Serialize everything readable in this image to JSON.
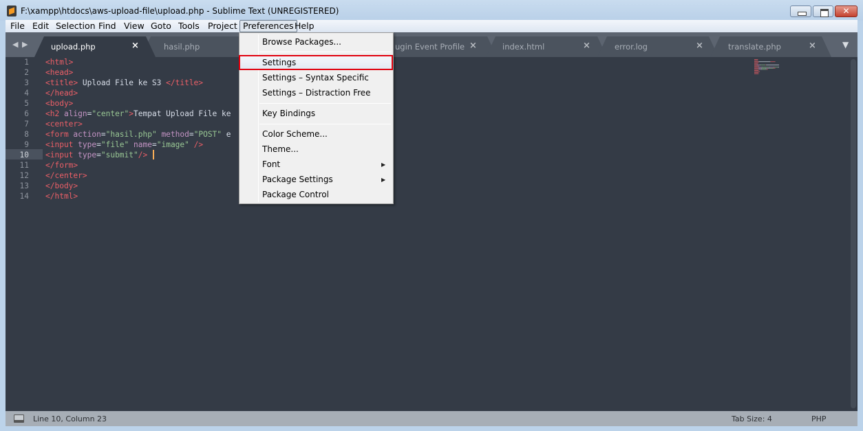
{
  "window": {
    "title": "F:\\xampp\\htdocs\\aws-upload-file\\upload.php - Sublime Text (UNREGISTERED)",
    "close_glyph": "✕"
  },
  "menubar": {
    "items": [
      "File",
      "Edit",
      "Selection",
      "Find",
      "View",
      "Goto",
      "Tools",
      "Project",
      "Preferences",
      "Help"
    ],
    "open": "Preferences"
  },
  "tabs": [
    {
      "label": "upload.php",
      "active": true
    },
    {
      "label": "hasil.php",
      "active": false
    },
    {
      "label": "ugin Event Profile",
      "active": false
    },
    {
      "label": "index.html",
      "active": false
    },
    {
      "label": "error.log",
      "active": false
    },
    {
      "label": "translate.php",
      "active": false
    }
  ],
  "tab_nav": "◀ ▶",
  "tab_close": "×",
  "tab_overflow": "▼",
  "editor": {
    "current_line": 10,
    "lines": [
      [
        [
          "tag",
          "<html>"
        ]
      ],
      [
        [
          "tag",
          "<head>"
        ]
      ],
      [
        [
          "tag",
          "<title>"
        ],
        [
          "text",
          " Upload File ke S3 "
        ],
        [
          "tag",
          "</title>"
        ]
      ],
      [
        [
          "tag",
          "</head>"
        ]
      ],
      [
        [
          "tag",
          "<body>"
        ]
      ],
      [
        [
          "tag",
          "<h2 "
        ],
        [
          "attr",
          "align"
        ],
        [
          "text",
          "="
        ],
        [
          "str",
          "\"center\""
        ],
        [
          "tag",
          ">"
        ],
        [
          "text",
          "Tempat Upload File ke"
        ]
      ],
      [
        [
          "tag",
          "<center>"
        ]
      ],
      [
        [
          "tag",
          "<form "
        ],
        [
          "attr",
          "action"
        ],
        [
          "text",
          "="
        ],
        [
          "str",
          "\"hasil.php\""
        ],
        [
          "text",
          " "
        ],
        [
          "attr",
          "method"
        ],
        [
          "text",
          "="
        ],
        [
          "str",
          "\"POST\""
        ],
        [
          "text",
          " e"
        ]
      ],
      [
        [
          "tag",
          "<input "
        ],
        [
          "attr",
          "type"
        ],
        [
          "text",
          "="
        ],
        [
          "str",
          "\"file\""
        ],
        [
          "text",
          " "
        ],
        [
          "attr",
          "name"
        ],
        [
          "text",
          "="
        ],
        [
          "str",
          "\"image\""
        ],
        [
          "tag",
          " />"
        ]
      ],
      [
        [
          "tag",
          "<input "
        ],
        [
          "attr",
          "type"
        ],
        [
          "text",
          "="
        ],
        [
          "str",
          "\"submit\""
        ],
        [
          "tag",
          "/>"
        ]
      ],
      [
        [
          "tag",
          "</form>"
        ]
      ],
      [
        [
          "tag",
          "</center>"
        ]
      ],
      [
        [
          "tag",
          "</body>"
        ]
      ],
      [
        [
          "tag",
          "</html>"
        ]
      ]
    ]
  },
  "preferences_menu": {
    "items": [
      {
        "label": "Browse Packages..."
      },
      {
        "label": "Settings",
        "highlighted": true
      },
      {
        "label": "Settings – Syntax Specific"
      },
      {
        "label": "Settings – Distraction Free"
      },
      {
        "label": "Key Bindings"
      },
      {
        "label": "Color Scheme..."
      },
      {
        "label": "Theme..."
      },
      {
        "label": "Font",
        "submenu": true
      },
      {
        "label": "Package Settings",
        "submenu": true
      },
      {
        "label": "Package Control"
      }
    ],
    "submenu_arrow": "▶",
    "highlight_color": "#e0000d"
  },
  "statusbar": {
    "position": "Line 10, Column 23",
    "tab_size": "Tab Size: 4",
    "syntax": "PHP"
  },
  "colors": {
    "editor_bg": "#343b46",
    "tag": "#ec5f67",
    "attr": "#c594c5",
    "string": "#99c794",
    "text": "#d8dee9",
    "cursor": "#f9ae58"
  }
}
